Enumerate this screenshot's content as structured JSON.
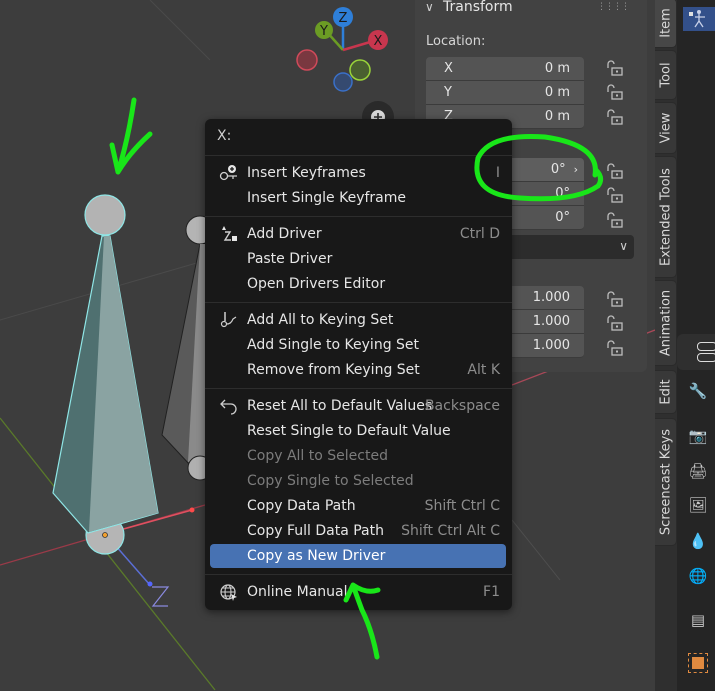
{
  "viewport": {
    "gizmo": {
      "x_label": "X",
      "y_label": "Y",
      "z_label": "Z"
    },
    "zoom_button_icon": "plus-icon",
    "object_gizmo_label": "Z"
  },
  "transform_panel": {
    "title": "Transform",
    "location_label": "Location:",
    "location": [
      {
        "axis": "X",
        "value": "0 m"
      },
      {
        "axis": "Y",
        "value": "0 m"
      },
      {
        "axis": "Z",
        "value": "0 m"
      }
    ],
    "rotation": [
      {
        "value": "0°"
      },
      {
        "value": "0°"
      },
      {
        "value": "0°"
      }
    ],
    "scale": [
      {
        "value": "1.000"
      },
      {
        "value": "1.000"
      },
      {
        "value": "1.000"
      }
    ],
    "rotation_mode_dropdown": "chevron-down-icon"
  },
  "side_tabs": [
    {
      "label": "Item",
      "active": true
    },
    {
      "label": "Tool",
      "active": false
    },
    {
      "label": "View",
      "active": false
    },
    {
      "label": "Extended Tools",
      "active": false
    },
    {
      "label": "Animation",
      "active": false
    },
    {
      "label": "Edit",
      "active": false
    },
    {
      "label": "Screencast Keys",
      "active": false
    }
  ],
  "properties_tabs": [
    {
      "icon": "armature-pose-icon",
      "active": true
    },
    {
      "icon": "toggle-icon"
    },
    {
      "icon": "tool-icon"
    },
    {
      "icon": "render-icon"
    },
    {
      "icon": "output-icon"
    },
    {
      "icon": "view-layer-icon"
    },
    {
      "icon": "scene-icon"
    },
    {
      "icon": "world-icon"
    },
    {
      "icon": "collection-icon"
    },
    {
      "icon": "object-icon"
    }
  ],
  "context_menu": {
    "title": "X:",
    "items": [
      {
        "label": "Insert Keyframes",
        "shortcut": "I",
        "icon": "keyframe-insert-icon",
        "disabled": false
      },
      {
        "label": "Insert Single Keyframe",
        "shortcut": "",
        "disabled": false
      },
      {
        "label": "Add Driver",
        "shortcut": "Ctrl D",
        "icon": "driver-icon",
        "disabled": false
      },
      {
        "label": "Paste Driver",
        "shortcut": "",
        "disabled": false
      },
      {
        "label": "Open Drivers Editor",
        "shortcut": "",
        "disabled": false
      },
      {
        "label": "Add All to Keying Set",
        "shortcut": "",
        "icon": "keying-set-icon",
        "disabled": false
      },
      {
        "label": "Add Single to Keying Set",
        "shortcut": "",
        "disabled": false
      },
      {
        "label": "Remove from Keying Set",
        "shortcut": "Alt K",
        "disabled": false
      },
      {
        "label": "Reset All to Default Values",
        "shortcut": "Backspace",
        "icon": "undo-icon",
        "disabled": false
      },
      {
        "label": "Reset Single to Default Value",
        "shortcut": "",
        "disabled": false
      },
      {
        "label": "Copy All to Selected",
        "shortcut": "",
        "disabled": true
      },
      {
        "label": "Copy Single to Selected",
        "shortcut": "",
        "disabled": true
      },
      {
        "label": "Copy Data Path",
        "shortcut": "Shift Ctrl C",
        "disabled": false
      },
      {
        "label": "Copy Full Data Path",
        "shortcut": "Shift Ctrl Alt C",
        "disabled": false
      },
      {
        "label": "Copy as New Driver",
        "shortcut": "",
        "disabled": false,
        "highlighted": true
      },
      {
        "label": "Online Manual",
        "shortcut": "F1",
        "icon": "globe-icon",
        "disabled": false
      }
    ]
  },
  "colors": {
    "accent": "#4772b3",
    "annotation": "#19e619",
    "axis_x": "#c8364e",
    "axis_y": "#6b9c24",
    "axis_z": "#2e7fd9",
    "selection_outline": "#7fe0e0"
  }
}
